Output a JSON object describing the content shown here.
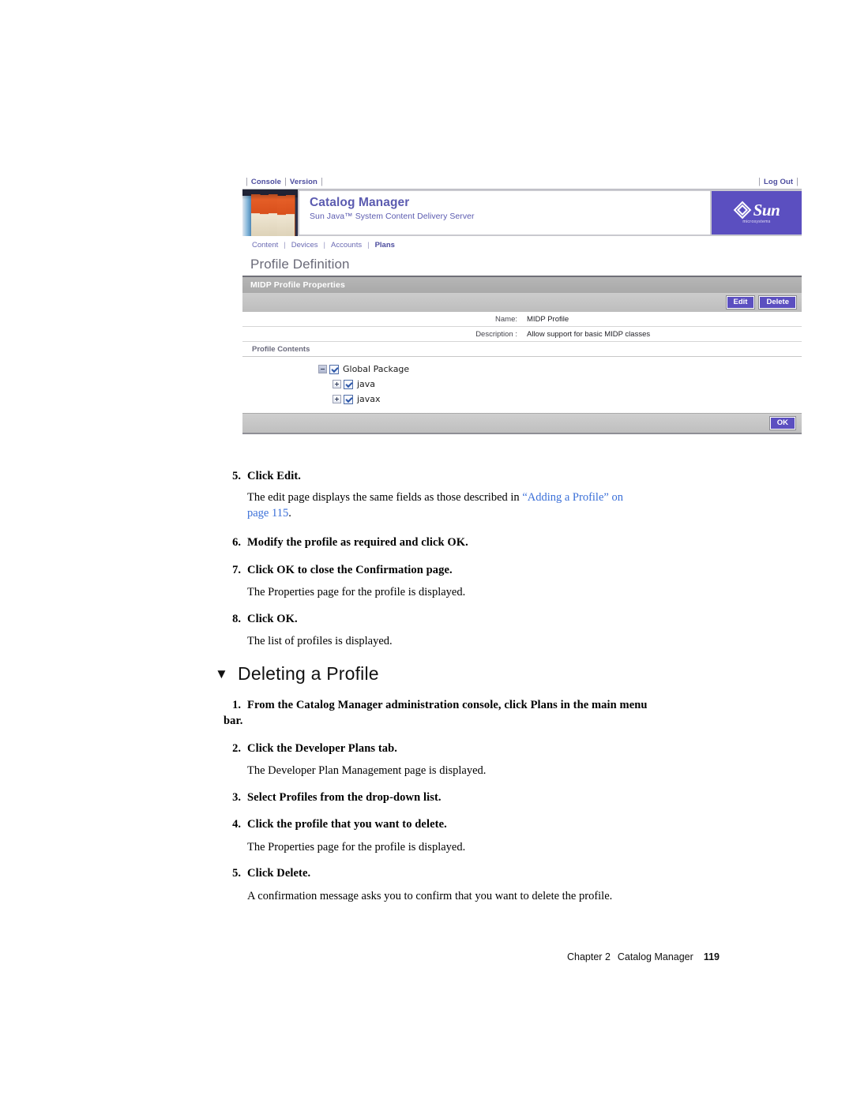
{
  "screenshot": {
    "utility_bar": {
      "links": [
        "Console",
        "Version"
      ],
      "logout_label": "Log Out"
    },
    "masthead": {
      "title": "Catalog Manager",
      "subtitle": "Sun Java™ System Content Delivery Server",
      "logo_word": "Sun",
      "logo_tagline": "microsystems",
      "logo_bg_color": "#5b4fc0",
      "thumbnail_name": "bookshelf-photo"
    },
    "module_tabs": [
      {
        "label": "Content",
        "active": false
      },
      {
        "label": "Devices",
        "active": false
      },
      {
        "label": "Accounts",
        "active": false
      },
      {
        "label": "Plans",
        "active": true
      }
    ],
    "page_heading": "Profile Definition",
    "panel": {
      "title": "MIDP Profile Properties",
      "buttons": {
        "edit": "Edit",
        "delete": "Delete",
        "ok": "OK"
      },
      "fields": [
        {
          "label": "Name:",
          "value": "MIDP Profile"
        },
        {
          "label": "Description :",
          "value": "Allow support for basic MIDP classes"
        }
      ],
      "contents_label": "Profile Contents",
      "tree": [
        {
          "label": "Global Package",
          "toggle": "minus",
          "checked": true,
          "level": 0
        },
        {
          "label": "java",
          "toggle": "plus",
          "checked": true,
          "level": 1
        },
        {
          "label": "javax",
          "toggle": "plus",
          "checked": true,
          "level": 1
        }
      ]
    }
  },
  "document": {
    "steps_first": [
      {
        "num": "5.",
        "text": "Click Edit."
      },
      {
        "num": "6.",
        "text": "Modify the profile as required and click OK."
      },
      {
        "num": "7.",
        "text": "Click OK to close the Confirmation page."
      },
      {
        "num": "8.",
        "text": "Click OK."
      }
    ],
    "para_edit_1": "The edit page displays the same fields as those described in ",
    "para_edit_link_1": "“Adding a Profile” on",
    "para_edit_link_2": "page 115",
    "para_edit_end": ".",
    "para_properties_1": "The Properties page for the profile is displayed.",
    "para_list_profiles": "The list of profiles is displayed.",
    "section_heading": "Deleting a Profile",
    "section_marker": "▼",
    "steps_second": [
      {
        "num": "1.",
        "line1": "From the Catalog Manager administration console, click Plans in the main menu",
        "line2": "bar."
      },
      {
        "num": "2.",
        "line1": "Click the Developer Plans tab.",
        "line2": ""
      },
      {
        "num": "3.",
        "line1": "Select Profiles from the drop-down list.",
        "line2": ""
      },
      {
        "num": "4.",
        "line1": "Click the profile that you want to delete.",
        "line2": ""
      },
      {
        "num": "5.",
        "line1": "Click Delete.",
        "line2": ""
      }
    ],
    "para_dev_plan": "The Developer Plan Management page is displayed.",
    "para_properties_2": "The Properties page for the profile is displayed.",
    "para_confirm": "A confirmation message asks you to confirm that you want to delete the profile."
  },
  "footer": {
    "chapter": "Chapter 2",
    "book": "Catalog Manager",
    "page_number": "119"
  }
}
